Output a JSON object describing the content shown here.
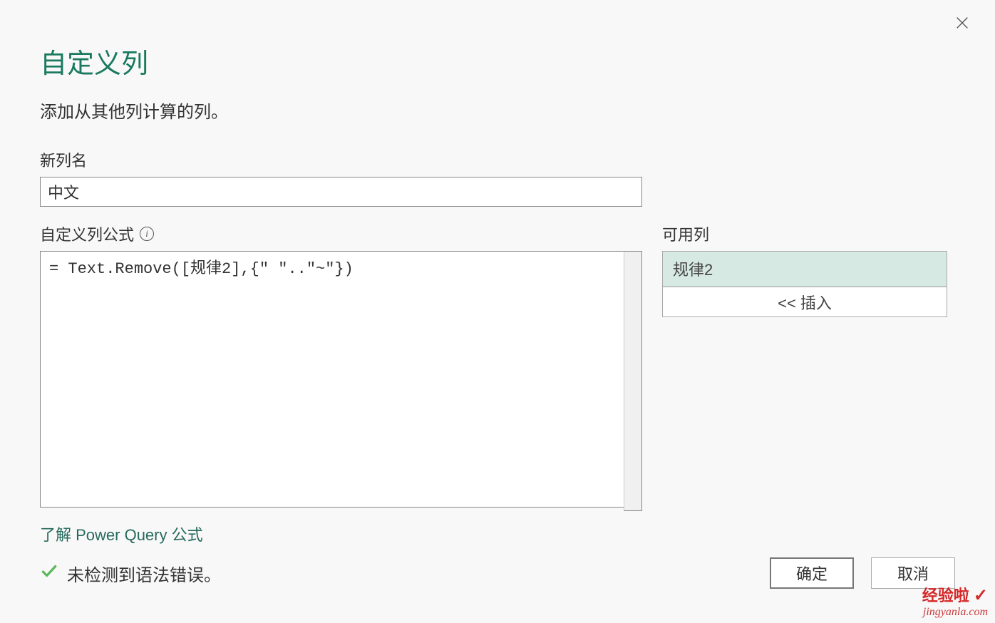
{
  "dialog": {
    "title": "自定义列",
    "subtitle": "添加从其他列计算的列。",
    "newname_label": "新列名",
    "newname_value": "中文",
    "formula_label": "自定义列公式",
    "formula_value": "= Text.Remove([规律2],{\" \"..\"~\"})",
    "available_label": "可用列",
    "columns": [
      "规律2"
    ],
    "insert_label": "<< 插入",
    "link_text": "了解 Power Query 公式",
    "status_text": "未检测到语法错误。",
    "ok_label": "确定",
    "cancel_label": "取消"
  },
  "watermark": {
    "brand": "经验啦",
    "site": "jingyanla.com"
  }
}
